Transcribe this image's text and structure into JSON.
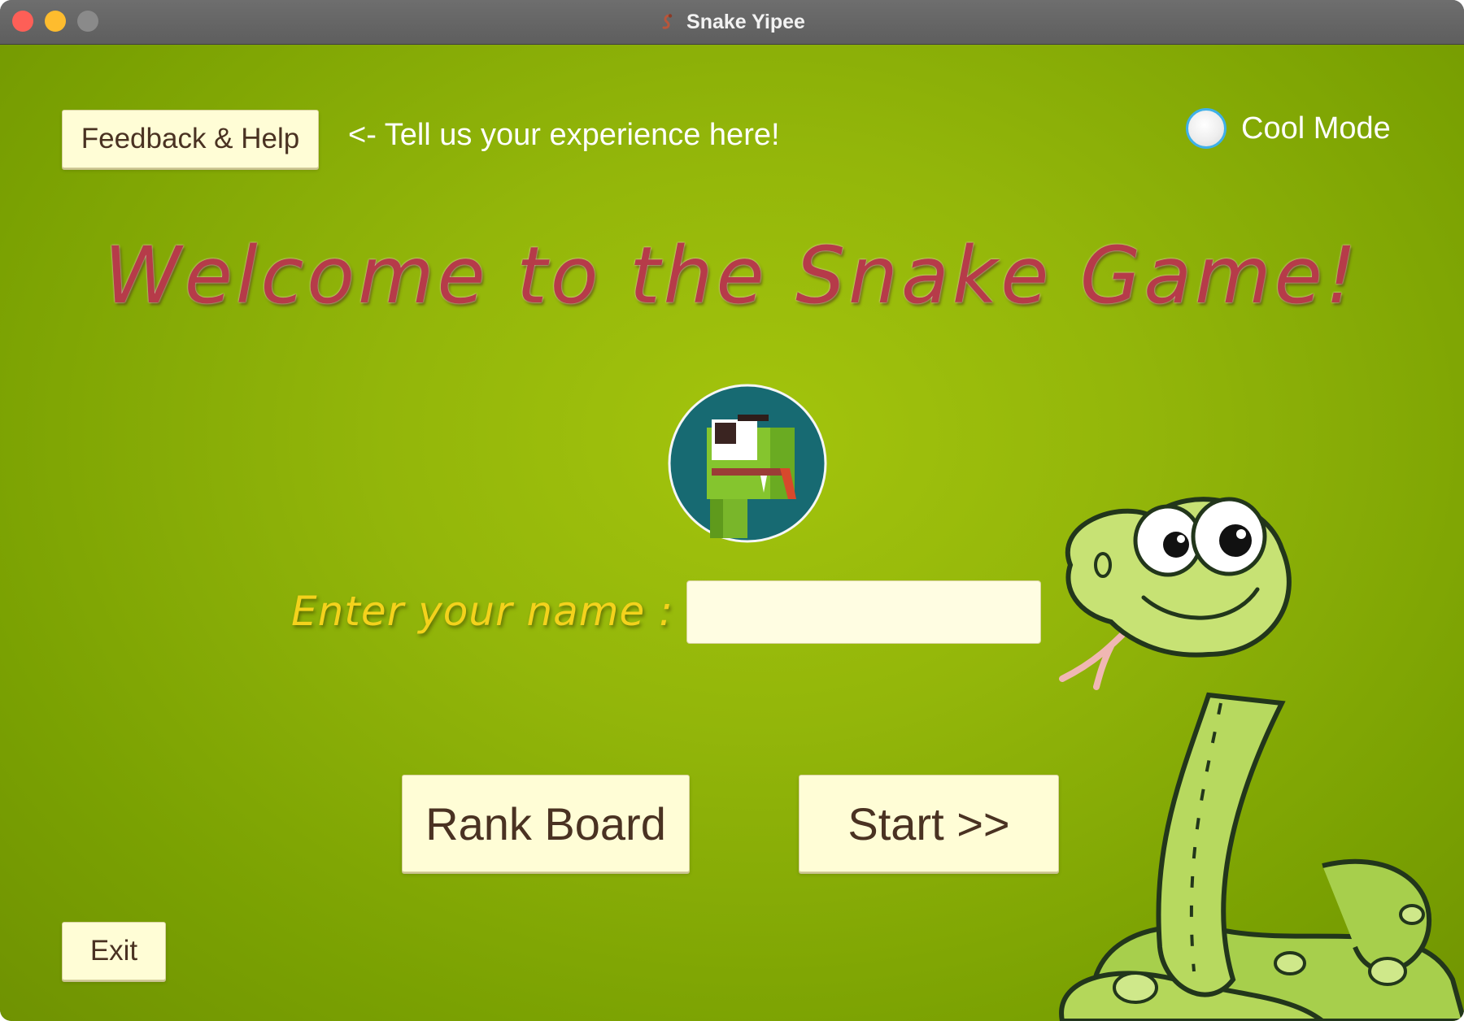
{
  "window": {
    "title": "Snake Yipee",
    "title_icon": "snake-icon"
  },
  "header": {
    "feedback_label": "Feedback & Help",
    "hint_text": "<-  Tell us your experience here!",
    "cool_mode_label": "Cool Mode",
    "cool_mode_checked": false
  },
  "main": {
    "welcome_text": "Welcome to the Snake Game!",
    "avatar_icon": "snake-avatar-icon",
    "name_label": "Enter your name :",
    "name_value": "",
    "rank_button_label": "Rank Board",
    "start_button_label": "Start >>",
    "exit_button_label": "Exit",
    "mascot": "cartoon-snake-mascot"
  },
  "colors": {
    "background": "#93b60a",
    "button_bg": "#fffdd6",
    "button_text": "#4a3222",
    "welcome_text": "#b63b49",
    "name_label": "#f4d21c",
    "radio_ring": "#3fb0e8"
  }
}
